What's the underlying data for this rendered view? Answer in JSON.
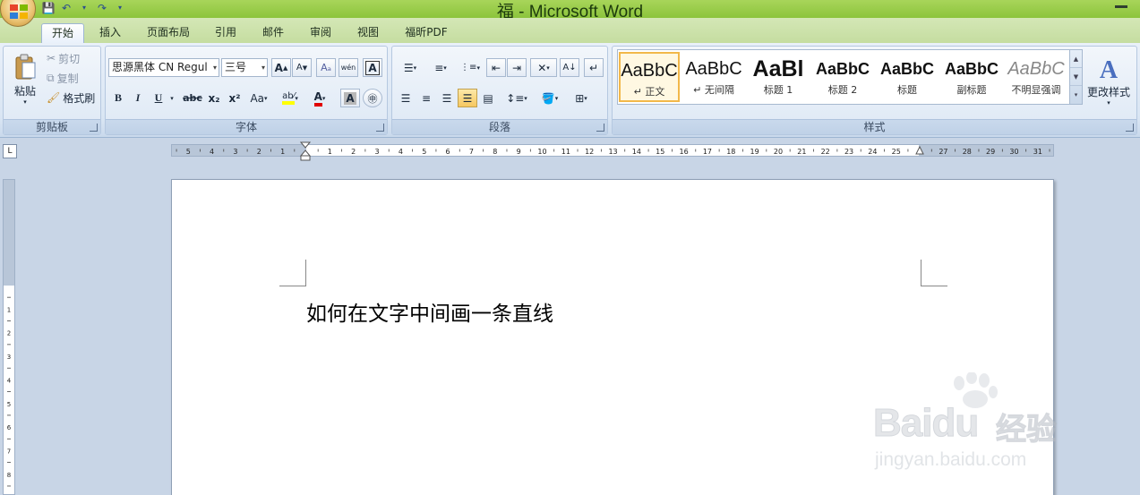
{
  "window": {
    "title": "福 - Microsoft Word"
  },
  "tabs": [
    {
      "label": "开始",
      "active": true
    },
    {
      "label": "插入"
    },
    {
      "label": "页面布局"
    },
    {
      "label": "引用"
    },
    {
      "label": "邮件"
    },
    {
      "label": "审阅"
    },
    {
      "label": "视图"
    },
    {
      "label": "福昕PDF"
    }
  ],
  "clipboard": {
    "label": "剪贴板",
    "paste": "粘贴",
    "cut": "剪切",
    "copy": "复制",
    "format_painter": "格式刷"
  },
  "font": {
    "label": "字体",
    "family": "思源黑体 CN Regul",
    "size": "三号",
    "bold": "B",
    "italic": "I",
    "underline": "U",
    "strikethrough": "abc",
    "subscript": "x₂",
    "superscript": "x²",
    "change_case": "Aa",
    "grow": "A",
    "shrink": "A",
    "phonetic": "wén"
  },
  "paragraph": {
    "label": "段落"
  },
  "styles": {
    "label": "样式",
    "items": [
      {
        "sample": "AaBbC",
        "name": "↵ 正文",
        "selected": true
      },
      {
        "sample": "AaBbC",
        "name": "↵ 无间隔"
      },
      {
        "sample": "AaBl",
        "name": "标题 1"
      },
      {
        "sample": "AaBbC",
        "name": "标题 2"
      },
      {
        "sample": "AaBbC",
        "name": "标题"
      },
      {
        "sample": "AaBbC",
        "name": "副标题"
      },
      {
        "sample": "AaBbC",
        "name": "不明显强调"
      }
    ],
    "change_styles": "更改样式"
  },
  "ruler": {
    "left_numbers": [
      "5",
      "4",
      "3",
      "2",
      "1"
    ],
    "right_numbers": [
      "1",
      "2",
      "3",
      "4",
      "5",
      "6",
      "7",
      "8",
      "9",
      "10",
      "11",
      "12",
      "13",
      "14",
      "15",
      "16",
      "17",
      "18",
      "19",
      "20",
      "21",
      "22",
      "23",
      "24",
      "25",
      "27",
      "28",
      "29",
      "30",
      "31"
    ]
  },
  "document": {
    "text": "如何在文字中间画一条直线"
  },
  "watermark": {
    "brand": "Baidu",
    "cn": "经验",
    "url": "jingyan.baidu.com"
  },
  "colors": {
    "title_bar": "#8cc43c",
    "ribbon": "#dde8f5",
    "highlight": "#ffff00",
    "font_color": "#e00000"
  }
}
